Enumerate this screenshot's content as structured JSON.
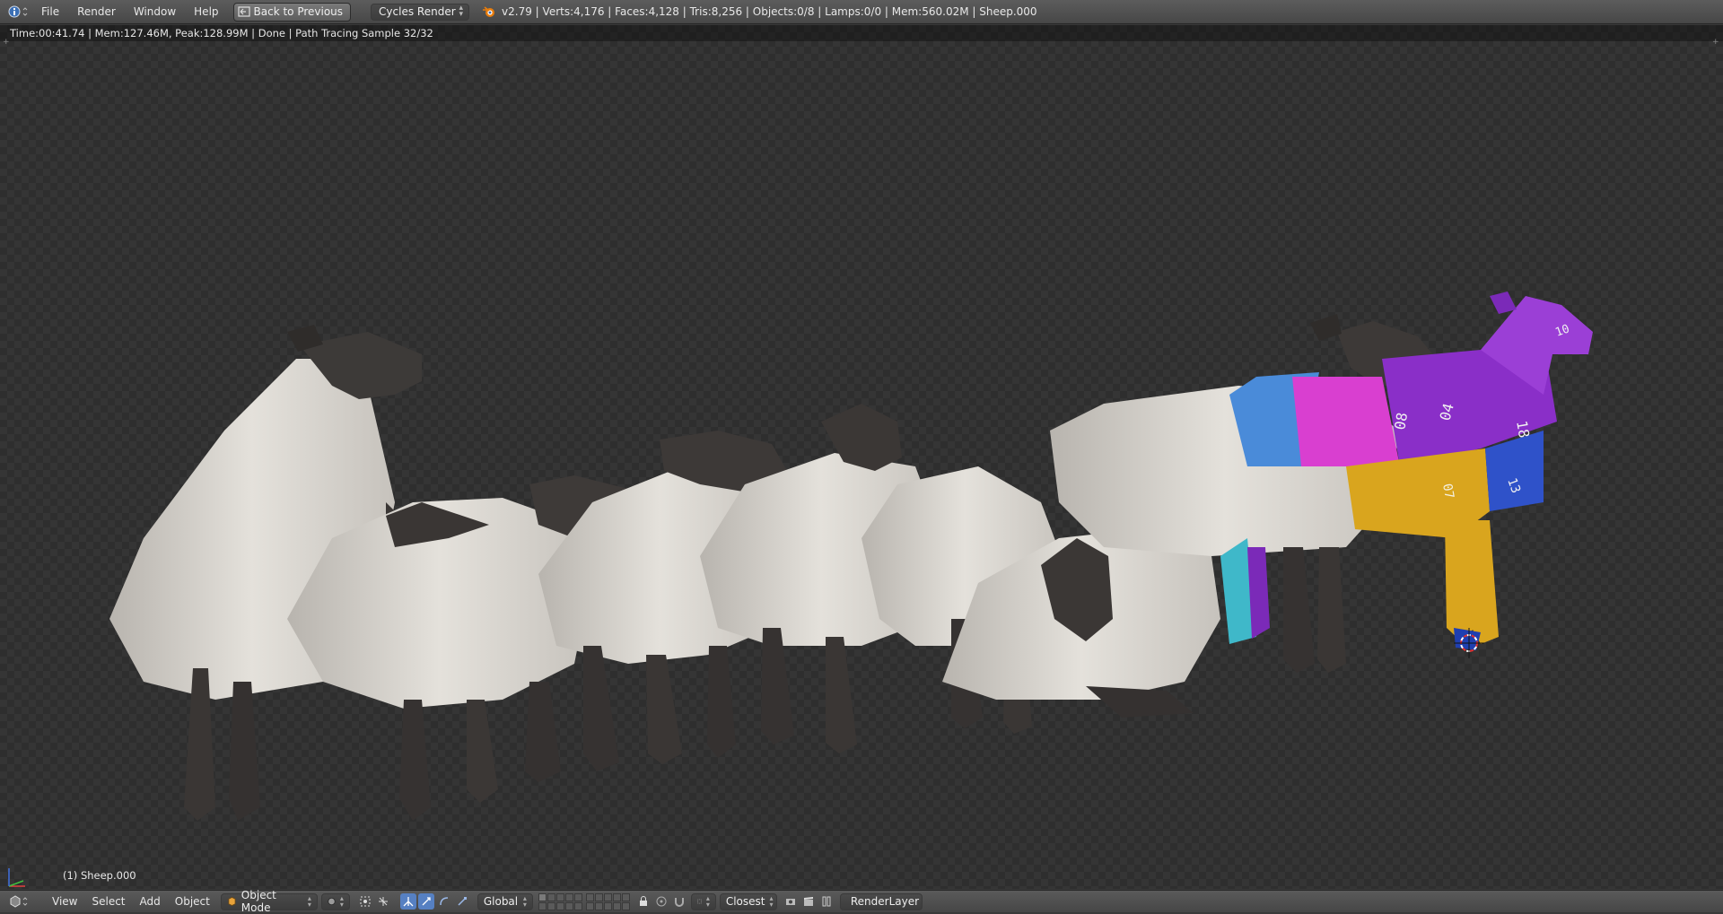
{
  "top_menu": {
    "items": [
      "File",
      "Render",
      "Window",
      "Help"
    ],
    "back_button": "Back to Previous",
    "render_engine": "Cycles Render",
    "stats": "v2.79 | Verts:4,176 | Faces:4,128 | Tris:8,256 | Objects:0/8 | Lamps:0/0 | Mem:560.02M | Sheep.000"
  },
  "viewport": {
    "render_info": "Time:00:41.74 | Mem:127.46M, Peak:128.99M | Done | Path Tracing Sample 32/32",
    "object_label": "(1) Sheep.000",
    "uv_labels": [
      "04",
      "18",
      "08",
      "07",
      "13",
      "10"
    ]
  },
  "bottom_bar": {
    "menu": [
      "View",
      "Select",
      "Add",
      "Object"
    ],
    "mode": "Object Mode",
    "orientation": "Global",
    "snap_target": "Closest",
    "render_layer": "RenderLayer"
  },
  "colors": {
    "header": "#4f4f4f",
    "viewport_bg": "#353535",
    "wool": "#d9d6d0",
    "head": "#3e3a38",
    "uv_purple": "#8a2fc8",
    "uv_magenta": "#d93fd0",
    "uv_yellow": "#d9a51e",
    "uv_blue": "#2f52c9",
    "uv_cyan": "#3fb8c9",
    "active_tool": "#5680c2"
  },
  "icons": [
    "info-icon",
    "render-icon",
    "blender-logo-icon",
    "view3d-editor-icon",
    "object-mode-icon",
    "viewport-shading-icon",
    "pivot-icon",
    "manipulator-icon",
    "translate-icon",
    "rotate-icon",
    "scale-icon",
    "snap-icon",
    "camera-icon",
    "clapper-icon",
    "render-layer-icon"
  ]
}
